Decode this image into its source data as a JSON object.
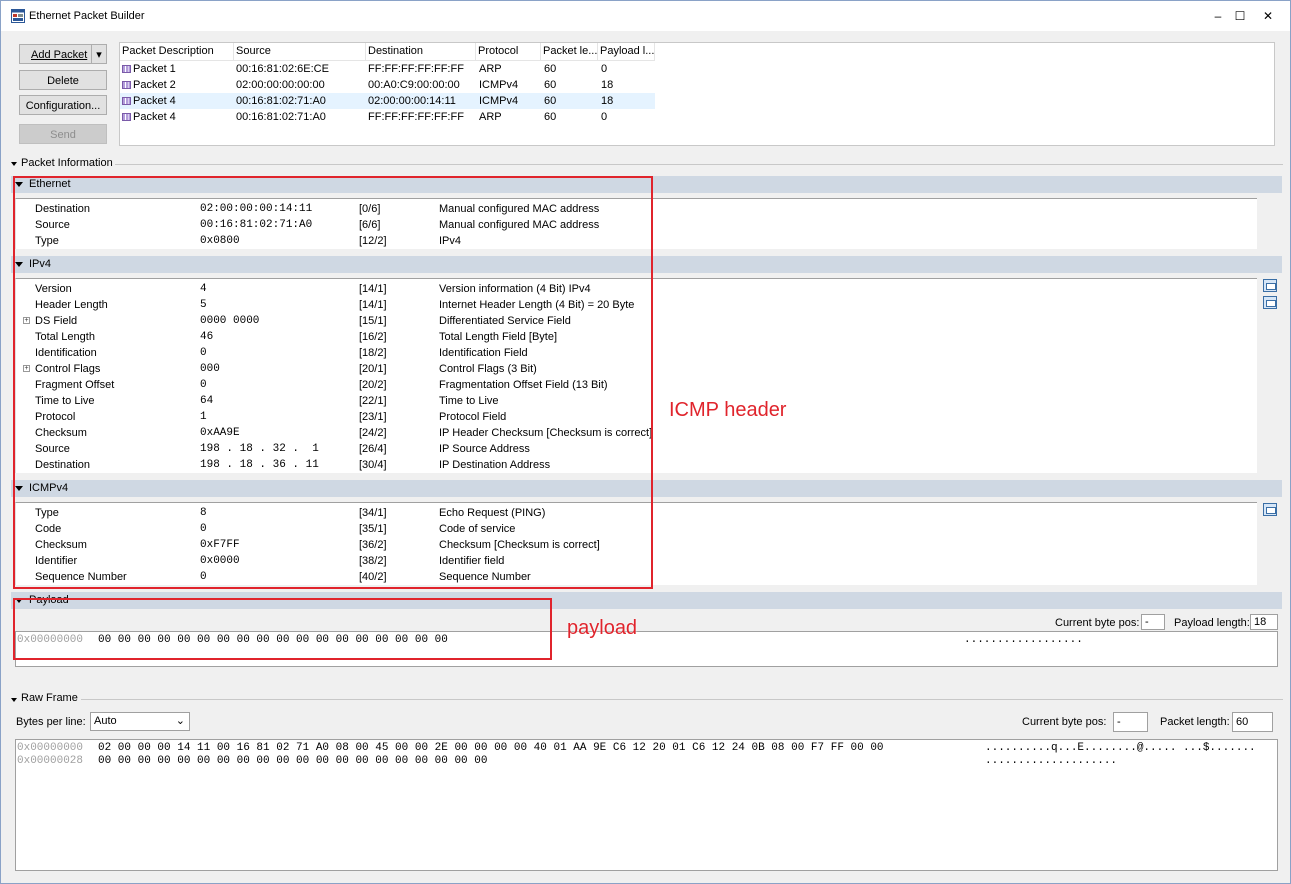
{
  "window": {
    "title": "Ethernet Packet Builder",
    "minimize": "–",
    "maximize": "☐",
    "close": "✕"
  },
  "toolbar": {
    "add_packet": "Add Packet",
    "add_packet_arrow": "▾",
    "delete": "Delete",
    "configuration": "Configuration...",
    "send": "Send"
  },
  "packet_list": {
    "columns": [
      "Packet Description",
      "Source",
      "Destination",
      "Protocol",
      "Packet le...",
      "Payload l..."
    ],
    "rows": [
      {
        "desc": "Packet 1",
        "src": "00:16:81:02:6E:CE",
        "dst": "FF:FF:FF:FF:FF:FF",
        "proto": "ARP",
        "plen": "60",
        "pay": "0"
      },
      {
        "desc": "Packet 2",
        "src": "02:00:00:00:00:00",
        "dst": "00:A0:C9:00:00:00",
        "proto": "ICMPv4",
        "plen": "60",
        "pay": "18"
      },
      {
        "desc": "Packet 4",
        "src": "00:16:81:02:71:A0",
        "dst": "02:00:00:00:14:11",
        "proto": "ICMPv4",
        "plen": "60",
        "pay": "18"
      },
      {
        "desc": "Packet 4",
        "src": "00:16:81:02:71:A0",
        "dst": "FF:FF:FF:FF:FF:FF",
        "proto": "ARP",
        "plen": "60",
        "pay": "0"
      }
    ]
  },
  "packet_info": {
    "label": "Packet Information",
    "ethernet": {
      "title": "Ethernet",
      "fields": [
        {
          "name": "Destination",
          "value": "02:00:00:00:14:11",
          "pos": "[0/6]",
          "desc": "Manual configured MAC address"
        },
        {
          "name": "Source",
          "value": "00:16:81:02:71:A0",
          "pos": "[6/6]",
          "desc": "Manual configured MAC address"
        },
        {
          "name": "Type",
          "value": "0x0800",
          "pos": "[12/2]",
          "desc": "IPv4"
        }
      ]
    },
    "ipv4": {
      "title": "IPv4",
      "fields": [
        {
          "name": "Version",
          "value": "4",
          "pos": "[14/1]",
          "desc": "Version information (4 Bit) IPv4",
          "exp": ""
        },
        {
          "name": "Header Length",
          "value": "5",
          "pos": "[14/1]",
          "desc": "Internet Header Length (4 Bit) = 20 Byte",
          "exp": ""
        },
        {
          "name": "DS Field",
          "value": "0000 0000",
          "pos": "[15/1]",
          "desc": "Differentiated Service Field",
          "exp": "+"
        },
        {
          "name": "Total Length",
          "value": "46",
          "pos": "[16/2]",
          "desc": "Total Length Field [Byte]",
          "exp": ""
        },
        {
          "name": "Identification",
          "value": "0",
          "pos": "[18/2]",
          "desc": "Identification Field",
          "exp": ""
        },
        {
          "name": "Control Flags",
          "value": "000",
          "pos": "[20/1]",
          "desc": "Control Flags (3 Bit)",
          "exp": "+"
        },
        {
          "name": "Fragment Offset",
          "value": "0",
          "pos": "[20/2]",
          "desc": "Fragmentation Offset Field (13 Bit)",
          "exp": ""
        },
        {
          "name": "Time to Live",
          "value": "64",
          "pos": "[22/1]",
          "desc": "Time to Live",
          "exp": ""
        },
        {
          "name": "Protocol",
          "value": "1",
          "pos": "[23/1]",
          "desc": "Protocol Field",
          "exp": ""
        },
        {
          "name": "Checksum",
          "value": "0xAA9E",
          "pos": "[24/2]",
          "desc": "IP Header Checksum [Checksum is correct]",
          "exp": ""
        },
        {
          "name": "Source",
          "value": "198 . 18 . 32 .  1",
          "pos": "[26/4]",
          "desc": "IP Source Address",
          "exp": ""
        },
        {
          "name": "Destination",
          "value": "198 . 18 . 36 . 11",
          "pos": "[30/4]",
          "desc": "IP Destination Address",
          "exp": ""
        }
      ]
    },
    "icmpv4": {
      "title": "ICMPv4",
      "fields": [
        {
          "name": "Type",
          "value": "8",
          "pos": "[34/1]",
          "desc": "Echo Request (PING)"
        },
        {
          "name": "Code",
          "value": "0",
          "pos": "[35/1]",
          "desc": "Code of service"
        },
        {
          "name": "Checksum",
          "value": "0xF7FF",
          "pos": "[36/2]",
          "desc": "Checksum [Checksum is correct]"
        },
        {
          "name": "Identifier",
          "value": "0x0000",
          "pos": "[38/2]",
          "desc": "Identifier field"
        },
        {
          "name": "Sequence Number",
          "value": "0",
          "pos": "[40/2]",
          "desc": "Sequence Number"
        }
      ]
    },
    "payload": {
      "title": "Payload",
      "current_byte_pos_label": "Current byte pos:",
      "current_byte_pos": "-",
      "payload_length_label": "Payload length:",
      "payload_length": "18",
      "offset": "0x00000000",
      "hex": "00 00 00 00 00 00 00 00 00 00 00 00 00 00 00 00 00 00",
      "ascii": ".................."
    }
  },
  "raw_frame": {
    "label": "Raw Frame",
    "bytes_per_line_label": "Bytes per line:",
    "bytes_per_line": "Auto",
    "current_byte_pos_label": "Current byte pos:",
    "current_byte_pos": "-",
    "packet_length_label": "Packet length:",
    "packet_length": "60",
    "lines": [
      {
        "offset": "0x00000000",
        "hex": "02 00 00 00 14 11 00 16 81 02 71 A0 08 00 45 00 00 2E 00 00 00 00 40 01 AA 9E C6 12 20 01 C6 12 24 0B 08 00 F7 FF 00 00",
        "ascii": "..........q...E........@..... ...$......."
      },
      {
        "offset": "0x00000028",
        "hex": "00 00 00 00 00 00 00 00 00 00 00 00 00 00 00 00 00 00 00 00",
        "ascii": "...................."
      }
    ]
  },
  "annotations": {
    "icmp_header": "ICMP header",
    "payload": "payload",
    "color": "#e0242c"
  }
}
